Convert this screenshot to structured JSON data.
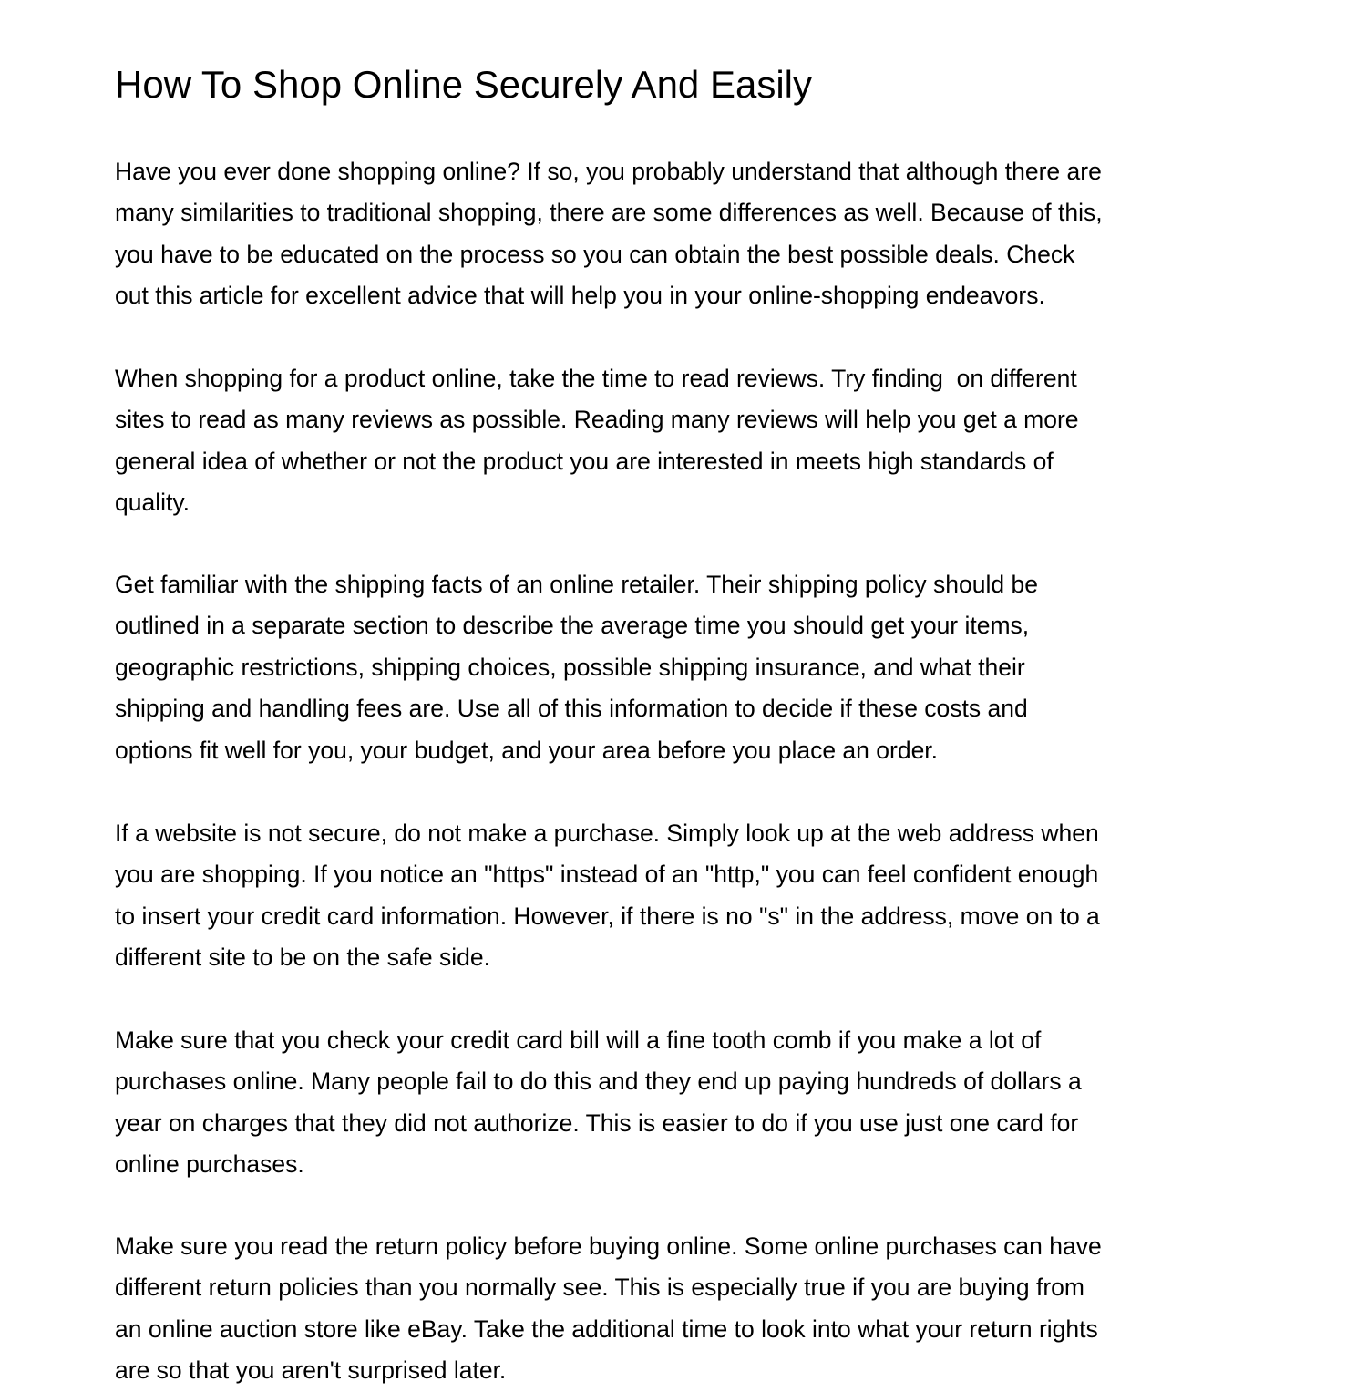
{
  "document": {
    "title": "How To Shop Online Securely And Easily",
    "paragraphs": [
      {
        "lines": [
          "Have you ever done shopping online? If so, you probably understand that although there are",
          "many similarities to traditional shopping, there are some differences as well. Because of this,",
          "you have to be educated on the process so you can obtain the best possible deals. Check",
          "out this article for excellent advice that will help you in your online-shopping endeavors."
        ]
      },
      {
        "lines": [
          "When shopping for a product online, take the time to read reviews. Try finding  on different",
          "sites to read as many reviews as possible. Reading many reviews will help you get a more",
          "general idea of whether or not the product you are interested in meets high standards of",
          "quality."
        ]
      },
      {
        "lines": [
          "Get familiar with the shipping facts of an online retailer. Their shipping policy should be",
          "outlined in a separate section to describe the average time you should get your items,",
          "geographic restrictions, shipping choices, possible shipping insurance, and what their",
          "shipping and handling fees are. Use all of this information to decide if these costs and",
          "options fit well for you, your budget, and your area before you place an order."
        ]
      },
      {
        "lines": [
          "If a website is not secure, do not make a purchase. Simply look up at the web address when",
          "you are shopping. If you notice an \"https\" instead of an \"http,\" you can feel confident enough",
          "to insert your credit card information. However, if there is no \"s\" in the address, move on to a",
          "different site to be on the safe side."
        ]
      },
      {
        "lines": [
          "Make sure that you check your credit card bill will a fine tooth comb if you make a lot of",
          "purchases online. Many people fail to do this and they end up paying hundreds of dollars a",
          "year on charges that they did not authorize. This is easier to do if you use just one card for",
          "online purchases."
        ]
      },
      {
        "lines": [
          "Make sure you read the return policy before buying online. Some online purchases can have",
          "different return policies than you normally see. This is especially true if you are buying from",
          "an online auction store like eBay. Take the additional time to look into what your return rights",
          "are so that you aren't surprised later."
        ]
      }
    ]
  }
}
